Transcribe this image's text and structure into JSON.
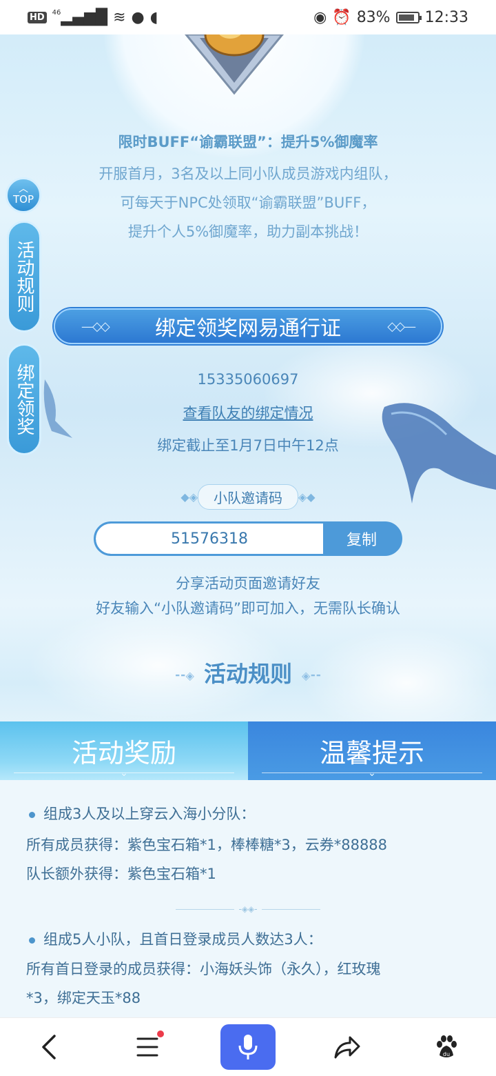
{
  "status_bar": {
    "hd": "HD",
    "network": "46",
    "battery": "83%",
    "time": "12:33"
  },
  "buff": {
    "title": "限时BUFF“谕霸联盟”：提升5%御魔率",
    "line1": "开服首月，3名及以上同小队成员游戏内组队，",
    "line2": "可每天于NPC处领取“谕霸联盟”BUFF，",
    "line3": "提升个人5%御魔率，助力副本挑战！"
  },
  "side": {
    "top_label": "TOP",
    "rules_tab": "活动规则",
    "bind_tab": "绑定领奖"
  },
  "bind": {
    "banner": "绑定领奖网易通行证",
    "phone": "15335060697",
    "teammate_link": "查看队友的绑定情况",
    "deadline": "绑定截止至1月7日中午12点"
  },
  "invite": {
    "label": "小队邀请码",
    "code": "51576318",
    "copy_button": "复制",
    "share1": "分享活动页面邀请好友",
    "share2": "好友输入“小队邀请码”即可加入，无需队长确认"
  },
  "rules": {
    "heading": "活动规则",
    "tabs": [
      "活动奖励",
      "温馨提示"
    ],
    "items": [
      {
        "title": "组成3人及以上穿云入海小分队：",
        "lines": [
          "所有成员获得：紫色宝石箱*1，棒棒糖*3，云券*88888",
          "队长额外获得：紫色宝石箱*1"
        ]
      },
      {
        "title": "组成5人小队，且首日登录成员人数达3人：",
        "lines": [
          "所有首日登录的成员获得：小海妖头饰（永久），红玫瑰",
          "*3，绑定天玉*88"
        ]
      }
    ]
  },
  "colors": {
    "accent": "#2c78d2",
    "text": "#4a86b8",
    "mic": "#4a6cf0"
  },
  "nav": {
    "icons": [
      "back-icon",
      "menu-icon",
      "microphone-icon",
      "share-icon",
      "baidu-paw-icon"
    ]
  }
}
